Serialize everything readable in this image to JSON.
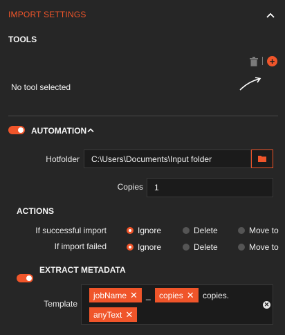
{
  "header": {
    "title": "IMPORT SETTINGS"
  },
  "tools": {
    "title": "TOOLS",
    "empty_text": "No tool selected"
  },
  "automation": {
    "label": "AUTOMATION",
    "enabled": true,
    "hotfolder": {
      "label": "Hotfolder",
      "value": "C:\\Users\\Documents\\Input folder"
    },
    "copies": {
      "label": "Copies",
      "value": "1"
    }
  },
  "actions": {
    "title": "ACTIONS",
    "rows": [
      {
        "label": "If successful import",
        "options": [
          "Ignore",
          "Delete",
          "Move to"
        ],
        "selected": "Ignore"
      },
      {
        "label": "If import failed",
        "options": [
          "Ignore",
          "Delete",
          "Move to"
        ],
        "selected": "Ignore"
      }
    ]
  },
  "metadata": {
    "label": "EXTRACT METADATA",
    "enabled": true,
    "template_label": "Template",
    "tokens": [
      {
        "type": "chip",
        "text": "jobName"
      },
      {
        "type": "text",
        "text": "_"
      },
      {
        "type": "chip",
        "text": "copies"
      },
      {
        "type": "text",
        "text": "copies."
      },
      {
        "type": "chip",
        "text": "anyText"
      }
    ]
  },
  "colors": {
    "accent": "#f0552a",
    "background": "#262626",
    "input": "#1b1b1b"
  },
  "icons": [
    "chevron-up-icon",
    "trash-icon",
    "plus-circle-icon",
    "arrow-icon",
    "folder-icon",
    "close-icon",
    "clear-icon"
  ]
}
